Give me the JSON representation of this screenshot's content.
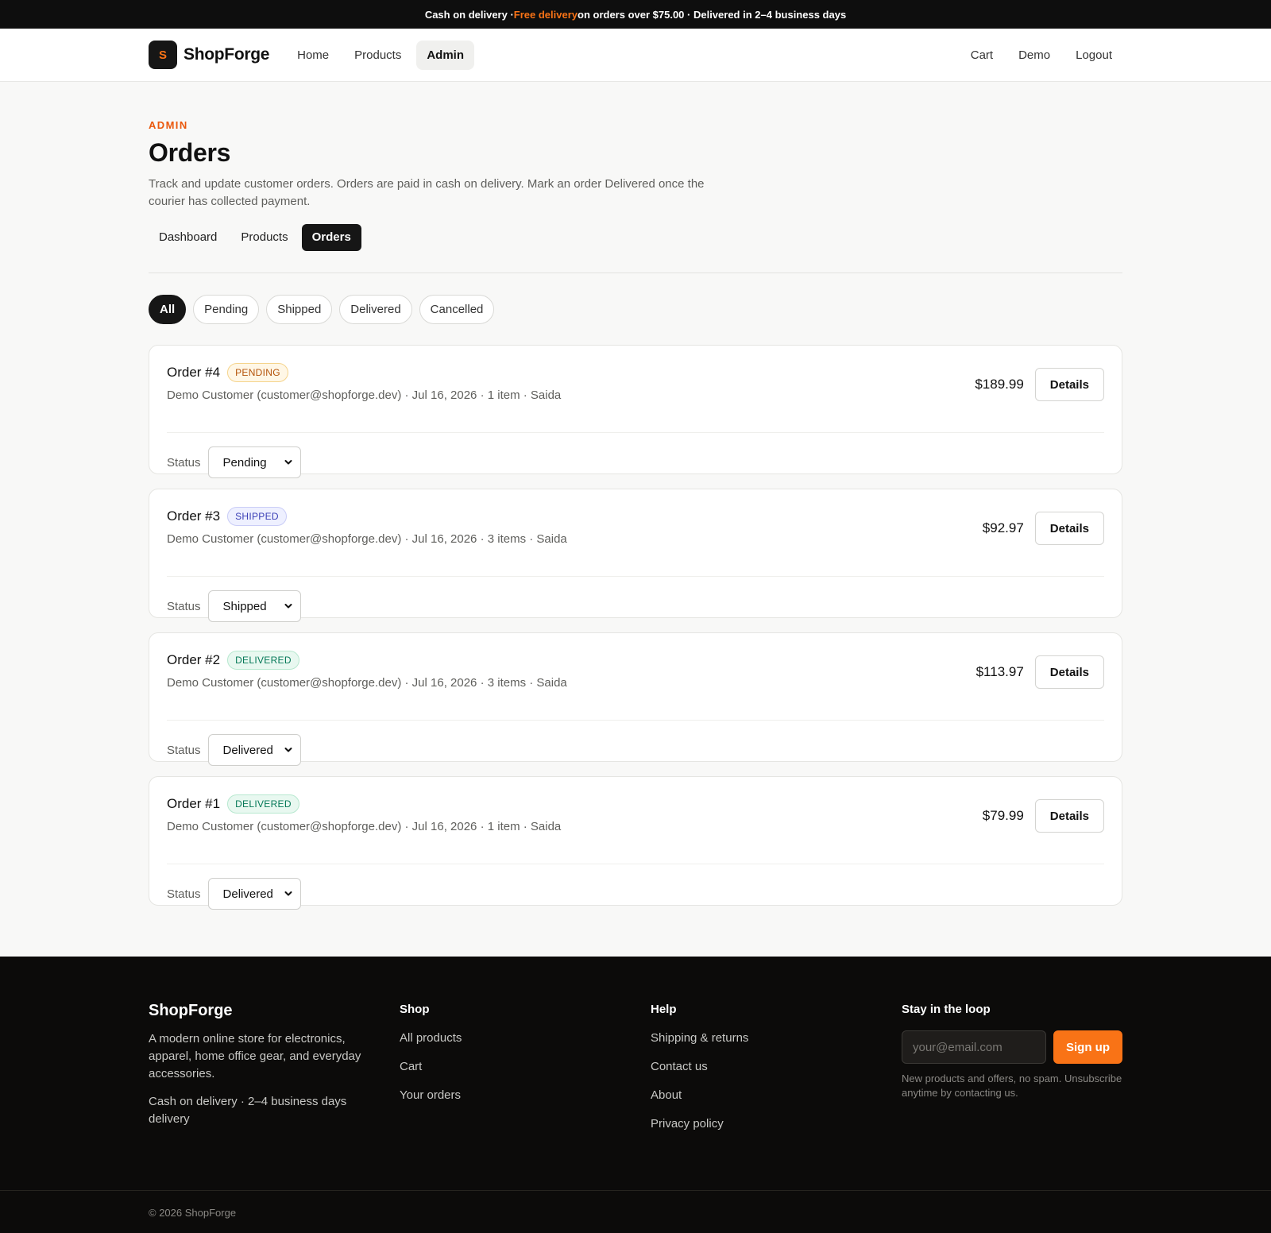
{
  "announcement": {
    "part1": "Cash on delivery · ",
    "highlight": "Free delivery",
    "part2": " on orders over $75.00 · Delivered in 2–4 business days"
  },
  "header": {
    "logo_letter": "S",
    "brand": "ShopForge",
    "nav": [
      "Home",
      "Products",
      "Admin"
    ],
    "nav_right": [
      "Cart",
      "Demo",
      "Logout"
    ]
  },
  "page": {
    "eyebrow": "ADMIN",
    "title": "Orders",
    "subtitle": "Track and update customer orders. Orders are paid in cash on delivery. Mark an order Delivered once the courier has collected payment.",
    "subnav": [
      "Dashboard",
      "Products",
      "Orders"
    ],
    "filters": [
      "All",
      "Pending",
      "Shipped",
      "Delivered",
      "Cancelled"
    ]
  },
  "orders": [
    {
      "title": "Order #4",
      "badge": "PENDING",
      "meta": "Demo Customer (customer@shopforge.dev) · Jul 16, 2026 · 1 item · Saida",
      "total": "$189.99",
      "details": "Details",
      "status_label": "Status",
      "status": "Pending"
    },
    {
      "title": "Order #3",
      "badge": "SHIPPED",
      "meta": "Demo Customer (customer@shopforge.dev) · Jul 16, 2026 · 3 items · Saida",
      "total": "$92.97",
      "details": "Details",
      "status_label": "Status",
      "status": "Shipped"
    },
    {
      "title": "Order #2",
      "badge": "DELIVERED",
      "meta": "Demo Customer (customer@shopforge.dev) · Jul 16, 2026 · 3 items · Saida",
      "total": "$113.97",
      "details": "Details",
      "status_label": "Status",
      "status": "Delivered"
    },
    {
      "title": "Order #1",
      "badge": "DELIVERED",
      "meta": "Demo Customer (customer@shopforge.dev) · Jul 16, 2026 · 1 item · Saida",
      "total": "$79.99",
      "details": "Details",
      "status_label": "Status",
      "status": "Delivered"
    }
  ],
  "footer": {
    "brand": "ShopForge",
    "desc": "A modern online store for electronics, apparel, home office gear, and everyday accessories.",
    "desc2": "Cash on delivery · 2–4 business days delivery",
    "shop_heading": "Shop",
    "shop_links": [
      "All products",
      "Cart",
      "Your orders"
    ],
    "help_heading": "Help",
    "help_links": [
      "Shipping & returns",
      "Contact us",
      "About",
      "Privacy policy"
    ],
    "newsletter_heading": "Stay in the loop",
    "email_placeholder": "your@email.com",
    "signup_label": "Sign up",
    "note": "New products and offers, no spam. Unsubscribe anytime by contacting us.",
    "copyright": "© 2026 ShopForge"
  },
  "colors": {
    "accent": "#f97316",
    "dark": "#161616"
  },
  "icons": {
    "select_chevron": "chevron-down-icon"
  }
}
